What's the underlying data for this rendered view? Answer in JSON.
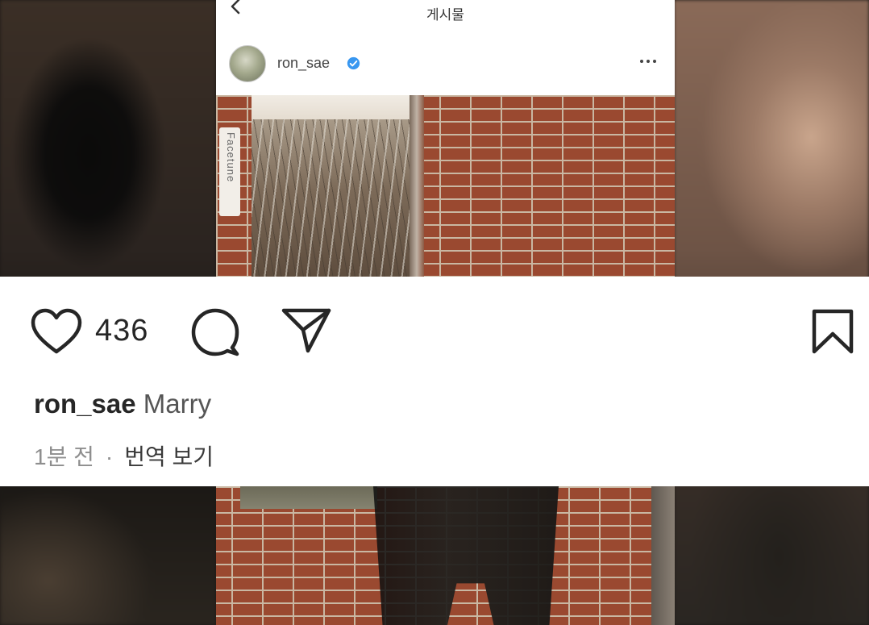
{
  "header": {
    "title": "게시물"
  },
  "post": {
    "author": "ron_sae",
    "verified": true,
    "watermark": "Facetune",
    "likes": "436",
    "caption_user": "ron_sae",
    "caption_text": "Marry",
    "time_ago": "1분 전",
    "separator": "·",
    "translate_label": "번역 보기"
  },
  "colors": {
    "verified": "#3897f0",
    "text": "#262626",
    "muted": "#8e8e8e"
  }
}
